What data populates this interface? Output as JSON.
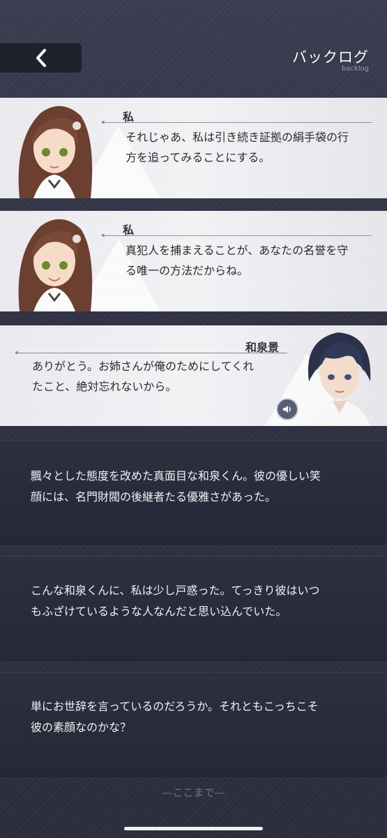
{
  "header": {
    "title": "バックログ",
    "subtitle": "backlog",
    "back_icon": "chevron-left-icon"
  },
  "entries": [
    {
      "speaker": "私",
      "text_line1": "それじゃあ、私は引き続き証拠の絹手袋の行",
      "text_line2": "方を追ってみることにする。"
    },
    {
      "speaker": "私",
      "text_line1": "真犯人を捕まえることが、あなたの名誉を守",
      "text_line2": "る唯一の方法だからね。"
    },
    {
      "speaker": "和泉景",
      "text_line1": "ありがとう。お姉さんが俺のためにしてくれ",
      "text_line2": "たこと、絶対忘れないから。",
      "voice_icon": "speaker-icon"
    }
  ],
  "narration": [
    {
      "line1": "飄々とした態度を改めた真面目な和泉くん。彼の優しい笑",
      "line2": "顔には、名門財閥の後継者たる優雅さがあった。"
    },
    {
      "line1": "こんな和泉くんに、私は少し戸惑った。てっきり彼はいつ",
      "line2": "もふざけているような人なんだと思い込んでいた。"
    },
    {
      "line1": "単にお世辞を言っているのだろうか。それともこっちこそ",
      "line2": "彼の素顔なのかな？"
    }
  ],
  "end_marker": "—ここまで—",
  "colors": {
    "card_bg": "#f0f0f4",
    "narration_bg": "#2a2d3c",
    "accent": "#5a5e74"
  }
}
